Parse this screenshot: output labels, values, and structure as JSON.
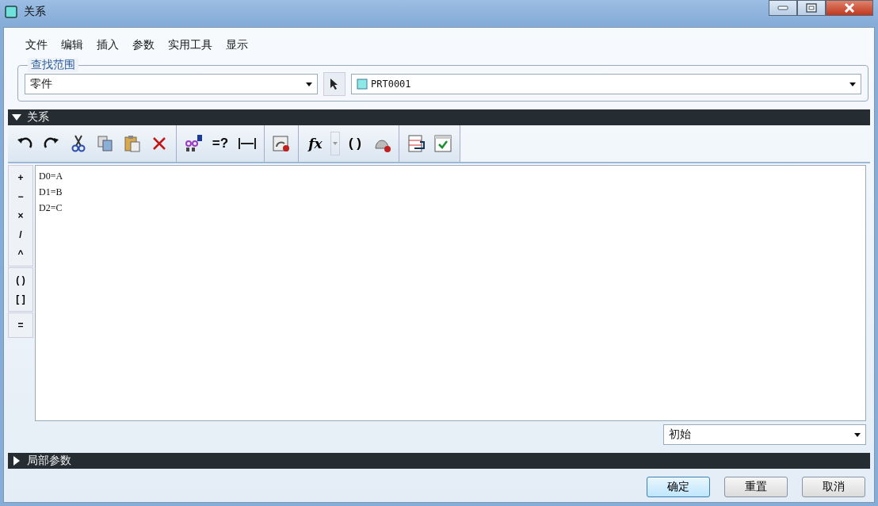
{
  "window": {
    "title": "关系"
  },
  "menu": [
    "文件",
    "编辑",
    "插入",
    "参数",
    "实用工具",
    "显示"
  ],
  "scope": {
    "legend": "查找范围",
    "type_value": "零件",
    "model_value": "PRT0001"
  },
  "relations_section": {
    "title": "关系",
    "expanded": true
  },
  "toolbar_texts": {
    "equals_query": "=?",
    "function": "fx",
    "brackets": "( )"
  },
  "operators": [
    [
      "+",
      "−",
      "×",
      "/",
      "^"
    ],
    [
      "( )",
      "[ ]"
    ],
    [
      "="
    ]
  ],
  "editor_lines": [
    "D0=A",
    "D1=B",
    "D2=C"
  ],
  "sort_mode": "初始",
  "local_params_section": {
    "title": "局部参数",
    "expanded": false
  },
  "buttons": [
    {
      "label": "确定",
      "default": true
    },
    {
      "label": "重置",
      "default": false
    },
    {
      "label": "取消",
      "default": false
    }
  ]
}
